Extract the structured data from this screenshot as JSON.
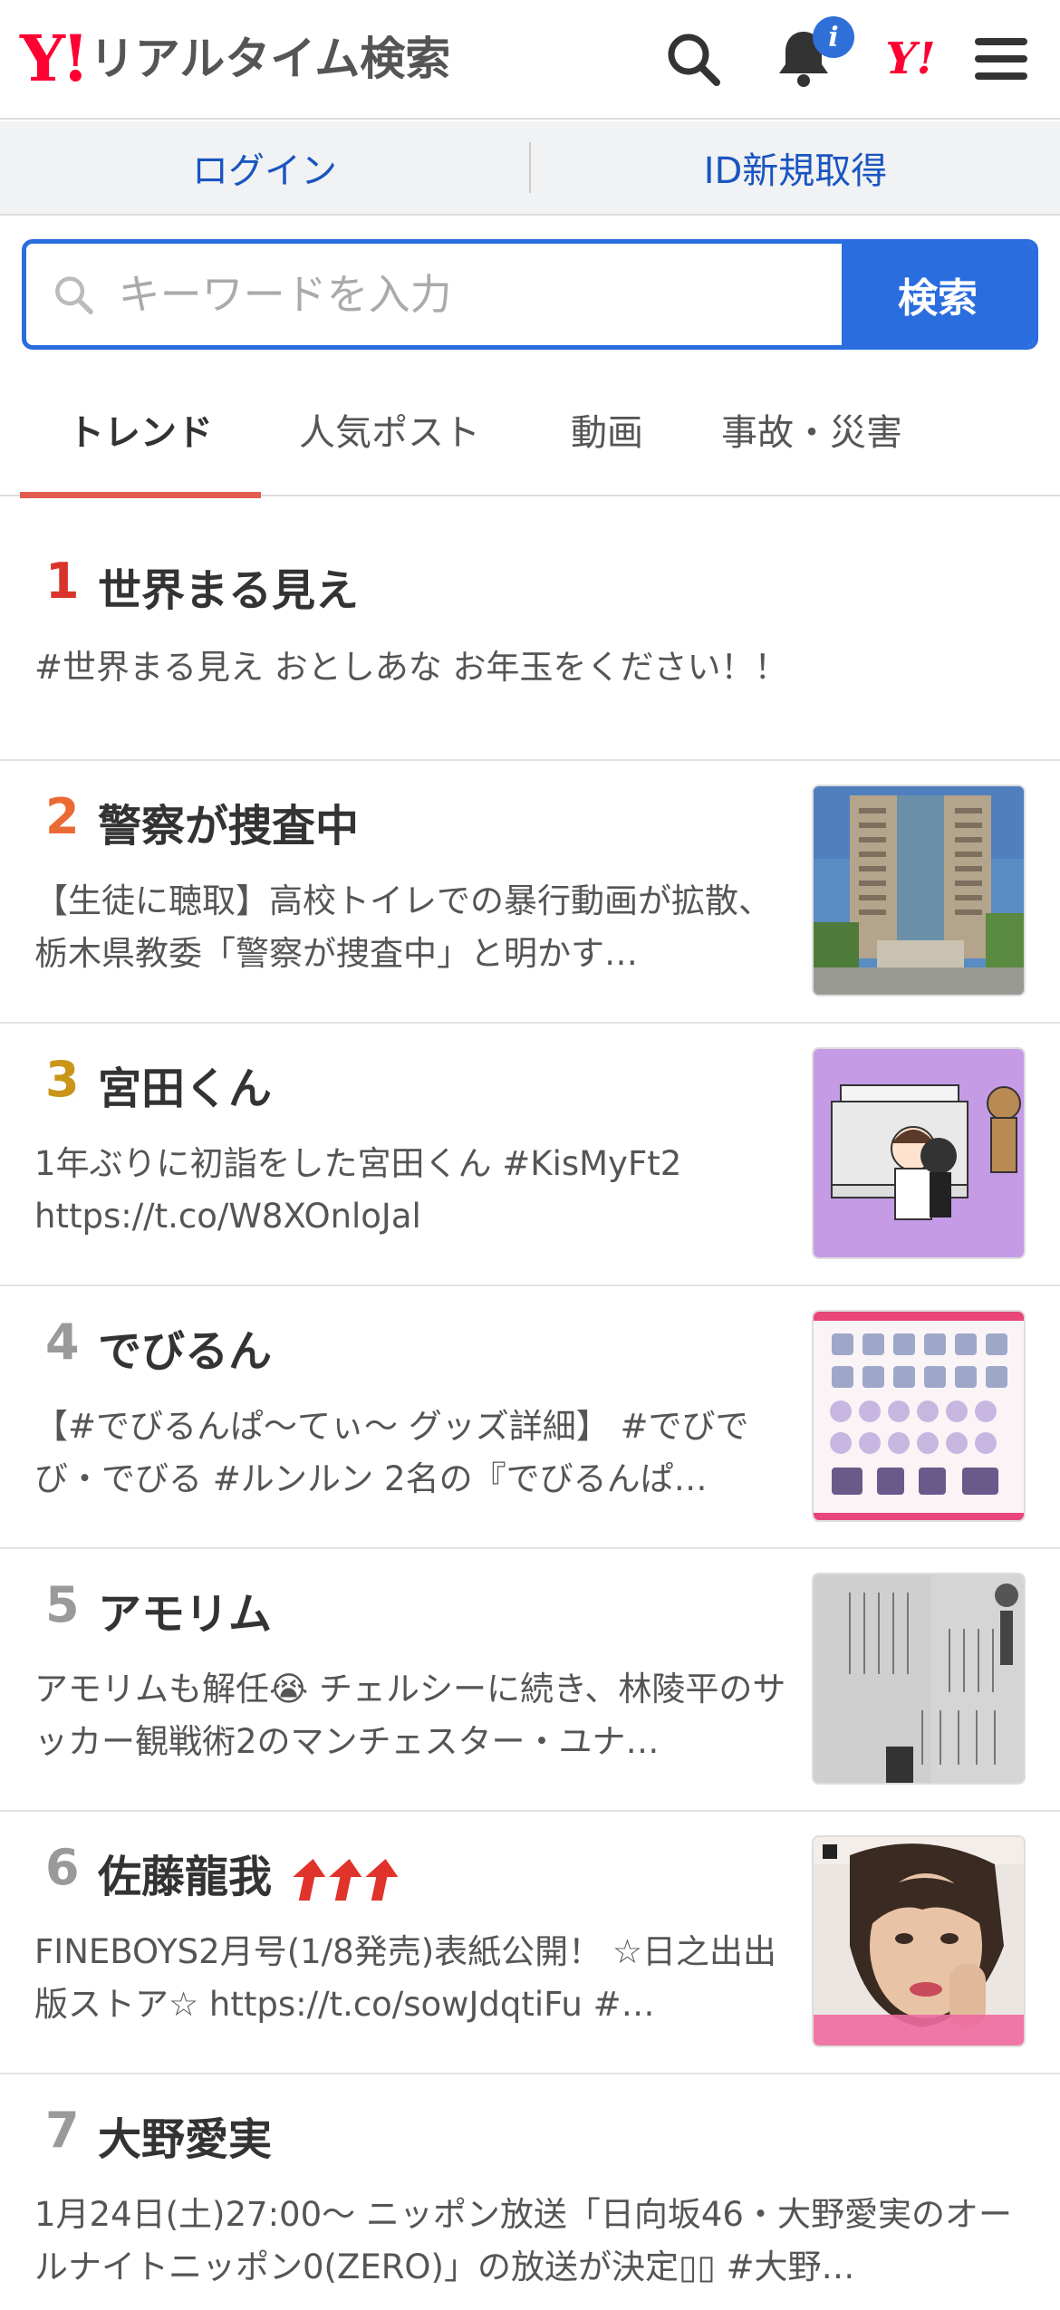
{
  "header": {
    "logo_mark": "Y!",
    "logo_text": "リアルタイム検索",
    "notification_badge": "i",
    "yahoo_mark": "Y!"
  },
  "login_bar": {
    "login": "ログイン",
    "register": "ID新規取得"
  },
  "search": {
    "placeholder": "キーワードを入力",
    "value": "",
    "button": "検索"
  },
  "tabs": [
    {
      "label": "トレンド",
      "active": true
    },
    {
      "label": "人気ポスト",
      "active": false
    },
    {
      "label": "動画",
      "active": false
    },
    {
      "label": "事故・災害",
      "active": false
    }
  ],
  "trends": [
    {
      "rank": "1",
      "rank_color": "#d9342b",
      "title": "世界まる見え",
      "desc": "#世界まる見え おとしあな お年玉をください！！",
      "thumb": null
    },
    {
      "rank": "2",
      "rank_color": "#ea6a33",
      "title": "警察が捜査中",
      "desc": "【生徒に聴取】高校トイレでの暴行動画が拡散、栃木県教委「警察が捜査中」と明かす…",
      "thumb": "building-photo"
    },
    {
      "rank": "3",
      "rank_color": "#c9961a",
      "title": "宮田くん",
      "desc": "1年ぶりに初詣をした宮田くん #KisMyFt2 https://t.co/W8XOnloJal",
      "thumb": "illustration"
    },
    {
      "rank": "4",
      "rank_color": "#9a9a9a",
      "title": "でびるん",
      "desc": "【#でびるんぱ〜てぃ〜 グッズ詳細】 #でびでび・でびる #ルンルン 2名の『でびるんぱ…",
      "thumb": "goods-list"
    },
    {
      "rank": "5",
      "rank_color": "#9a9a9a",
      "title": "アモリム",
      "desc": "アモリムも解任😭 チェルシーに続き、林陵平のサッカー観戦術2のマンチェスター・ユナ…",
      "thumb": "magazine-page"
    },
    {
      "rank": "6",
      "rank_color": "#9a9a9a",
      "title": "佐藤龍我",
      "desc": "FINEBOYS2月号(1/8発売)表紙公開！ ☆日之出出版ストア☆ https://t.co/sowJdqtiFu #…",
      "thumb": "magazine-cover",
      "rising": true
    },
    {
      "rank": "7",
      "rank_color": "#9a9a9a",
      "title": "大野愛実",
      "desc": "1月24日(土)27:00〜 ニッポン放送「日向坂46・大野愛実のオールナイトニッポン0(ZERO)」の放送が決定▯▯ #大野…",
      "thumb": null
    }
  ],
  "colors": {
    "accent_blue": "#2a6ddf",
    "link_blue": "#1a55c0",
    "yahoo_red": "#ff0033",
    "tab_indicator": "#e25c50"
  }
}
